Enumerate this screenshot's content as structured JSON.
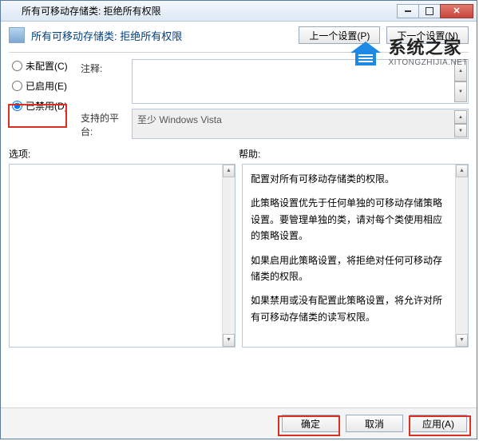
{
  "window": {
    "title": "所有可移动存储类: 拒绝所有权限"
  },
  "header": {
    "title": "所有可移动存储类: 拒绝所有权限",
    "prev_btn": "上一个设置(P)",
    "next_btn": "下一个设置(N)"
  },
  "radios": {
    "not_configured": "未配置(C)",
    "enabled": "已启用(E)",
    "disabled": "已禁用(D)"
  },
  "fields": {
    "comment_label": "注释:",
    "platform_label": "支持的平台:",
    "platform_value": "至少 Windows Vista"
  },
  "section": {
    "options_label": "选项:",
    "help_label": "帮助:"
  },
  "help": {
    "p1": "配置对所有可移动存储类的权限。",
    "p2": "此策略设置优先于任何单独的可移动存储策略设置。要管理单独的类，请对每个类使用相应的策略设置。",
    "p3": "如果启用此策略设置，将拒绝对任何可移动存储类的权限。",
    "p4": "如果禁用或没有配置此策略设置，将允许对所有可移动存储类的读写权限。"
  },
  "footer": {
    "ok": "确定",
    "cancel": "取消",
    "apply": "应用(A)"
  },
  "watermark": {
    "cn": "系统之家",
    "en": "XITONGZHIJIA.NET"
  }
}
